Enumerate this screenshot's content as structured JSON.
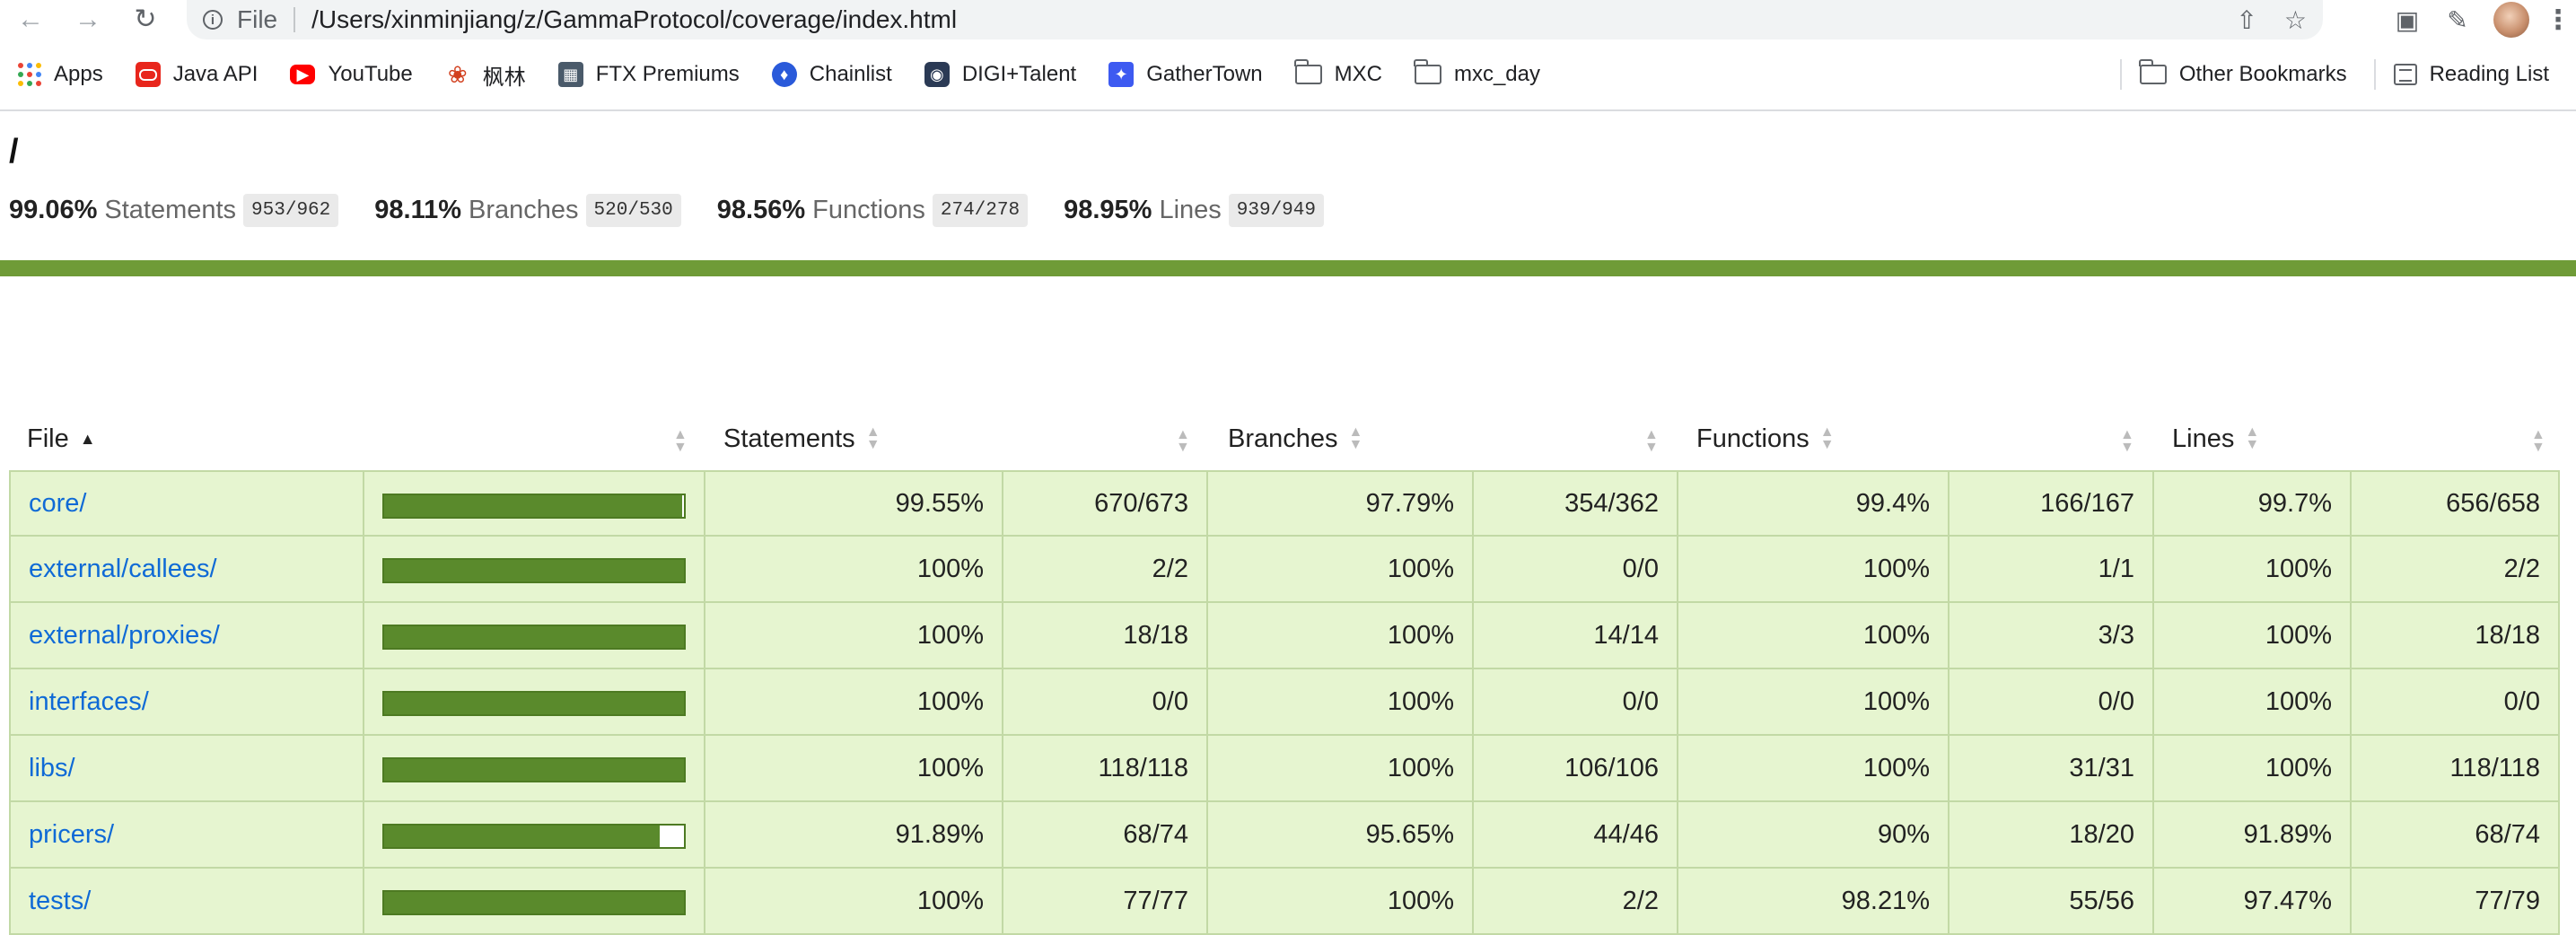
{
  "browser": {
    "scheme": "File",
    "url": "/Users/xinminjiang/z/GammaProtocol/coverage/index.html",
    "icons": [
      "back-icon",
      "forward-icon",
      "reload-icon",
      "info-icon",
      "share-icon",
      "star-icon",
      "cast-icon",
      "extensions-icon",
      "avatar",
      "menu-icon"
    ]
  },
  "bookmarks": {
    "items": [
      {
        "label": "Apps",
        "icon": "apps-icon"
      },
      {
        "label": "Java API",
        "icon": "oracle-icon"
      },
      {
        "label": "YouTube",
        "icon": "youtube-icon"
      },
      {
        "label": "枫林",
        "icon": "maple-leaf-icon"
      },
      {
        "label": "FTX Premiums",
        "icon": "ftx-icon"
      },
      {
        "label": "Chainlist",
        "icon": "chainlist-icon"
      },
      {
        "label": "DIGI+Talent",
        "icon": "digi-talent-icon"
      },
      {
        "label": "GatherTown",
        "icon": "gathertown-icon"
      },
      {
        "label": "MXC",
        "icon": "folder-icon"
      },
      {
        "label": "mxc_day",
        "icon": "folder-icon"
      }
    ],
    "other": "Other Bookmarks",
    "reading_list": "Reading List"
  },
  "page": {
    "breadcrumb": "/",
    "summary": [
      {
        "pct": "99.06%",
        "label": "Statements",
        "frac": "953/962"
      },
      {
        "pct": "98.11%",
        "label": "Branches",
        "frac": "520/530"
      },
      {
        "pct": "98.56%",
        "label": "Functions",
        "frac": "274/278"
      },
      {
        "pct": "98.95%",
        "label": "Lines",
        "frac": "939/949"
      }
    ],
    "status_color": "#6f9b37"
  },
  "table": {
    "headers": {
      "file": "File",
      "statements": "Statements",
      "branches": "Branches",
      "functions": "Functions",
      "lines": "Lines"
    },
    "rows": [
      {
        "file": "core/",
        "coverage": 0.9955,
        "stmt_pct": "99.55%",
        "stmt_frac": "670/673",
        "br_pct": "97.79%",
        "br_frac": "354/362",
        "fn_pct": "99.4%",
        "fn_frac": "166/167",
        "ln_pct": "99.7%",
        "ln_frac": "656/658"
      },
      {
        "file": "external/callees/",
        "coverage": 1.0,
        "stmt_pct": "100%",
        "stmt_frac": "2/2",
        "br_pct": "100%",
        "br_frac": "0/0",
        "fn_pct": "100%",
        "fn_frac": "1/1",
        "ln_pct": "100%",
        "ln_frac": "2/2"
      },
      {
        "file": "external/proxies/",
        "coverage": 1.0,
        "stmt_pct": "100%",
        "stmt_frac": "18/18",
        "br_pct": "100%",
        "br_frac": "14/14",
        "fn_pct": "100%",
        "fn_frac": "3/3",
        "ln_pct": "100%",
        "ln_frac": "18/18"
      },
      {
        "file": "interfaces/",
        "coverage": 1.0,
        "stmt_pct": "100%",
        "stmt_frac": "0/0",
        "br_pct": "100%",
        "br_frac": "0/0",
        "fn_pct": "100%",
        "fn_frac": "0/0",
        "ln_pct": "100%",
        "ln_frac": "0/0"
      },
      {
        "file": "libs/",
        "coverage": 1.0,
        "stmt_pct": "100%",
        "stmt_frac": "118/118",
        "br_pct": "100%",
        "br_frac": "106/106",
        "fn_pct": "100%",
        "fn_frac": "31/31",
        "ln_pct": "100%",
        "ln_frac": "118/118"
      },
      {
        "file": "pricers/",
        "coverage": 0.9189,
        "stmt_pct": "91.89%",
        "stmt_frac": "68/74",
        "br_pct": "95.65%",
        "br_frac": "44/46",
        "fn_pct": "90%",
        "fn_frac": "18/20",
        "ln_pct": "91.89%",
        "ln_frac": "68/74"
      },
      {
        "file": "tests/",
        "coverage": 1.0,
        "stmt_pct": "100%",
        "stmt_frac": "77/77",
        "br_pct": "100%",
        "br_frac": "2/2",
        "fn_pct": "98.21%",
        "fn_frac": "55/56",
        "ln_pct": "97.47%",
        "ln_frac": "77/79"
      }
    ]
  }
}
